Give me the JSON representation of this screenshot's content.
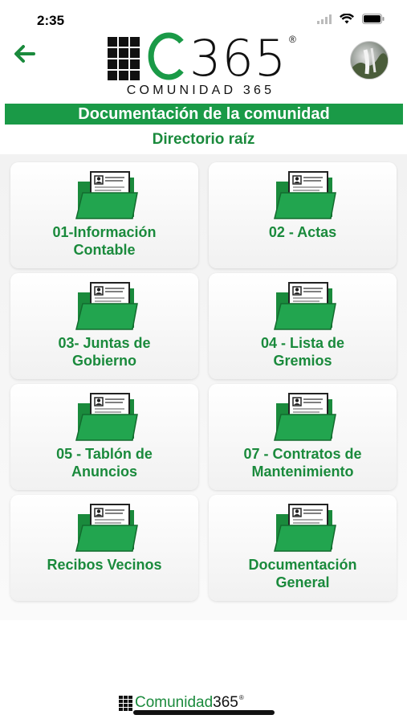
{
  "status": {
    "time": "2:35"
  },
  "header": {
    "logo_number": "C365",
    "logo_number_rest": "365",
    "logo_reg": "®",
    "logo_subtitle": "COMUNIDAD 365"
  },
  "page": {
    "title": "Documentación de la comunidad",
    "subtitle": "Directorio raíz"
  },
  "folders": [
    {
      "label_1": "01-Información",
      "label_2": "Contable"
    },
    {
      "label_1": "02 - Actas",
      "label_2": ""
    },
    {
      "label_1": "03- Juntas de",
      "label_2": "Gobierno"
    },
    {
      "label_1": "04 - Lista de",
      "label_2": "Gremios"
    },
    {
      "label_1": "05 - Tablón de",
      "label_2": "Anuncios"
    },
    {
      "label_1": "07 - Contratos de",
      "label_2": "Mantenimiento"
    },
    {
      "label_1": "Recibos Vecinos",
      "label_2": ""
    },
    {
      "label_1": "Documentación",
      "label_2": "General"
    }
  ],
  "footer": {
    "brand_text": "Comunidad",
    "brand_num": "365",
    "brand_reg": "®"
  },
  "colors": {
    "accent": "#1a9a47",
    "text_green": "#1a8a3c"
  },
  "icons": {
    "back": "arrow-left-icon",
    "folder": "folder-document-icon"
  }
}
